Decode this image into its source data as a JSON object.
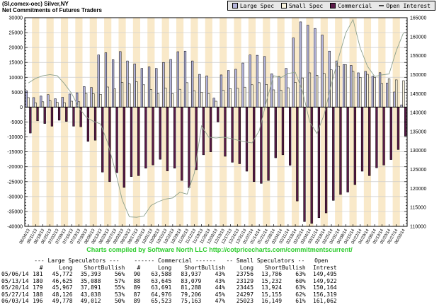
{
  "header": {
    "title_line1": "(SI,comex-oec) Silver,NY",
    "title_line2": "Net Commitments of Futures Traders"
  },
  "legend": {
    "items": [
      {
        "label": "Large Spec",
        "swatch": "large_spec"
      },
      {
        "label": "Small Spec",
        "swatch": "small_spec"
      },
      {
        "label": "Commercial",
        "swatch": "commercial"
      },
      {
        "label": "Open Interest",
        "swatch": "oi_marker"
      }
    ]
  },
  "colors": {
    "large_spec": "#b4b4dc",
    "small_spec": "#faf5e0",
    "commercial": "#5a1a48",
    "open_interest": "#8ca08c",
    "oi_marker": "#444444",
    "stripe": "#f9e9c9",
    "grid": "#cccccc",
    "axis": "#000000",
    "credit_green": "#2ecc2e",
    "legend_bg": "#e8e8e8"
  },
  "chart_data": {
    "type": "bar",
    "title": "Net Commitments of Futures Traders - (SI,comex-oec) Silver,NY",
    "grid": true,
    "legend_position": "top-right",
    "left_axis": {
      "min": -40000,
      "max": 30000,
      "step": 5000
    },
    "right_axis": {
      "min": 110000,
      "max": 165000,
      "step": 5000
    },
    "categories": [
      "06/04/13",
      "06/11/13",
      "06/18/13",
      "06/25/13",
      "07/02/13",
      "07/09/13",
      "07/16/13",
      "07/23/13",
      "07/30/13",
      "08/06/13",
      "08/13/13",
      "08/20/13",
      "08/27/13",
      "09/03/13",
      "09/10/13",
      "09/17/13",
      "09/24/13",
      "10/01/13",
      "10/08/13",
      "10/15/13",
      "10/22/13",
      "10/29/13",
      "11/05/13",
      "11/12/13",
      "11/19/13",
      "11/26/13",
      "12/03/13",
      "12/10/13",
      "12/17/13",
      "12/24/13",
      "12/31/13",
      "01/07/14",
      "01/14/14",
      "01/21/14",
      "01/28/14",
      "02/04/14",
      "02/11/14",
      "02/18/14",
      "02/25/14",
      "03/04/14",
      "03/11/14",
      "03/18/14",
      "03/25/14",
      "04/01/14",
      "04/08/14",
      "04/15/14",
      "04/22/14",
      "04/29/14",
      "05/06/14",
      "05/13/14",
      "05/20/14",
      "05/27/14",
      "06/03/14"
    ],
    "series": [
      {
        "name": "Large Spec",
        "type": "bar",
        "axis": "left",
        "values": [
          5500,
          3200,
          3700,
          4200,
          2800,
          3300,
          4400,
          4800,
          6900,
          6600,
          17500,
          18250,
          15900,
          18650,
          15500,
          14500,
          13000,
          13500,
          13000,
          15000,
          16000,
          18600,
          18800,
          15500,
          11000,
          10500,
          3000,
          10800,
          12300,
          12700,
          14800,
          17500,
          17400,
          17000,
          11200,
          10300,
          13000,
          23200,
          28600,
          27500,
          26400,
          24200,
          18800,
          15500,
          14300,
          14000,
          11500,
          12000,
          10379,
          11537,
          8076,
          5088,
          766
        ]
      },
      {
        "name": "Small Spec",
        "type": "bar",
        "axis": "left",
        "values": [
          3200,
          1400,
          1800,
          2200,
          1600,
          1500,
          2000,
          1800,
          4600,
          4500,
          4300,
          6750,
          6100,
          8300,
          7800,
          8500,
          7500,
          5900,
          4500,
          6400,
          4500,
          6000,
          8200,
          5500,
          5000,
          4500,
          2000,
          5700,
          6200,
          6300,
          6700,
          7500,
          8200,
          7600,
          5800,
          5700,
          6500,
          8300,
          9800,
          11500,
          10700,
          11300,
          12500,
          13800,
          14200,
          12000,
          10000,
          11000,
          9970,
          7897,
          9521,
          9142,
          8874
        ]
      },
      {
        "name": "Commercial",
        "type": "bar",
        "axis": "left",
        "values": [
          -8700,
          -4600,
          -5500,
          -6400,
          -4400,
          -4800,
          -6400,
          -6600,
          -11500,
          -11100,
          -21800,
          -25000,
          -22000,
          -26950,
          -23300,
          -23000,
          -20500,
          -19400,
          -17500,
          -21400,
          -20500,
          -24600,
          -27000,
          -21000,
          -16000,
          -15000,
          -5000,
          -16500,
          -18500,
          -19000,
          -21500,
          -25000,
          -25600,
          -24600,
          -17000,
          -16000,
          -19500,
          -31500,
          -38400,
          -39000,
          -37100,
          -35500,
          -31300,
          -29300,
          -28500,
          -26000,
          -21500,
          -23000,
          -20349,
          -19434,
          -17597,
          -14230,
          -9640
        ]
      },
      {
        "name": "Open Interest",
        "type": "line",
        "axis": "right",
        "values": [
          147800,
          149000,
          149700,
          150000,
          149700,
          147600,
          145000,
          141300,
          138800,
          137700,
          137000,
          132000,
          125000,
          117000,
          112500,
          112400,
          112700,
          115500,
          116500,
          117200,
          117500,
          119000,
          118500,
          124000,
          136500,
          133500,
          133300,
          133500,
          133200,
          132700,
          132300,
          132000,
          135200,
          143000,
          149700,
          149200,
          150300,
          150600,
          145600,
          137500,
          134500,
          139500,
          147500,
          154500,
          161000,
          164500,
          157000,
          152200,
          149495,
          149922,
          150164,
          156319,
          161062
        ]
      }
    ]
  },
  "footer": {
    "credit": "Charts compiled by Software North LLC  http://cotpricecharts.com/commitmentscurrent/"
  },
  "table": {
    "group_headers": [
      "--- Large Speculators ---",
      "------ Commercial ------",
      "-- Small Speculators --",
      "Open"
    ],
    "col_headers": [
      "",
      "#",
      "Long",
      "Short",
      "Bullish",
      "#",
      "Long",
      "Short",
      "Bullish",
      "Long",
      "Short",
      "Bullish",
      "Intrest"
    ],
    "rows": [
      [
        "05/06/14",
        "181",
        "45,772",
        "35,393",
        "56%",
        "90",
        "63,588",
        "83,937",
        "43%",
        "23756",
        "13,786",
        "63%",
        "149,495"
      ],
      [
        "05/13/14",
        "180",
        "46,625",
        "35,088",
        "57%",
        "88",
        "63,645",
        "83,079",
        "43%",
        "23129",
        "15,232",
        "60%",
        "149,922"
      ],
      [
        "05/20/14",
        "179",
        "45,967",
        "37,891",
        "55%",
        "89",
        "63,691",
        "81,288",
        "44%",
        "23445",
        "13,924",
        "63%",
        "150,164"
      ],
      [
        "05/27/14",
        "188",
        "48,126",
        "43,038",
        "53%",
        "87",
        "64,976",
        "79,206",
        "45%",
        "24297",
        "15,155",
        "62%",
        "156,319"
      ],
      [
        "06/03/14",
        "196",
        "49,778",
        "49,012",
        "50%",
        "89",
        "65,523",
        "75,163",
        "47%",
        "25023",
        "16,149",
        "61%",
        "161,062"
      ]
    ]
  }
}
